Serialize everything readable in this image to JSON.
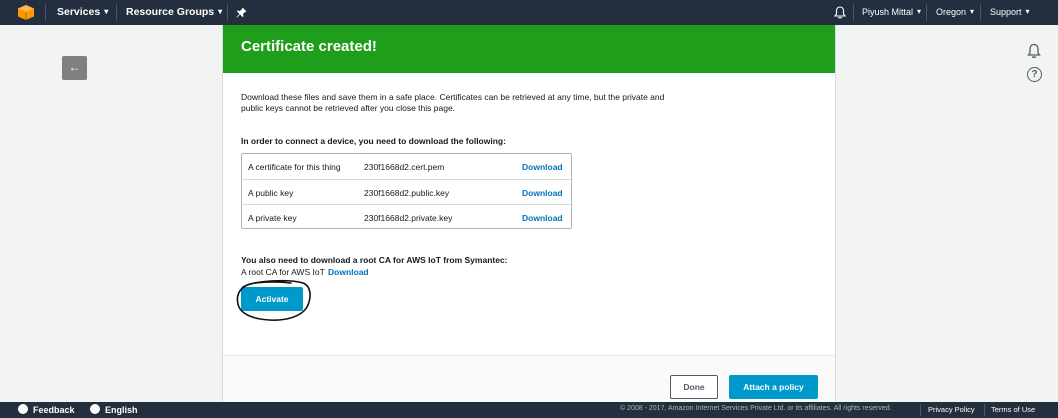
{
  "topnav": {
    "services": "Services",
    "resource_groups": "Resource Groups",
    "user": "Piyush Mittal",
    "region": "Oregon",
    "support": "Support"
  },
  "modal": {
    "title": "Certificate created!",
    "intro": "Download these files and save them in a safe place. Certificates can be retrieved at any time, but the private and public keys cannot be retrieved after you close this page.",
    "need_heading": "In order to connect a device, you need to download the following:",
    "files": [
      {
        "desc": "A certificate for this thing",
        "filename": "230f1668d2.cert.pem",
        "action": "Download"
      },
      {
        "desc": "A public key",
        "filename": "230f1668d2.public.key",
        "action": "Download"
      },
      {
        "desc": "A private key",
        "filename": "230f1668d2.private.key",
        "action": "Download"
      }
    ],
    "rootca_heading": "You also need to download a root CA for AWS IoT from Symantec:",
    "rootca_text": "A root CA for AWS IoT",
    "rootca_link": "Download",
    "activate": "Activate",
    "done": "Done",
    "attach_policy": "Attach a policy"
  },
  "bottombar": {
    "feedback": "Feedback",
    "language": "English",
    "copyright": "© 2008 - 2017, Amazon Internet Services Private Ltd. or its affiliates. All rights reserved.",
    "privacy": "Privacy Policy",
    "terms": "Terms of Use"
  },
  "colors": {
    "header_green": "#1e9e1a",
    "primary_button": "#0099cc",
    "link": "#0073bb",
    "nav_bg": "#232f3e"
  }
}
